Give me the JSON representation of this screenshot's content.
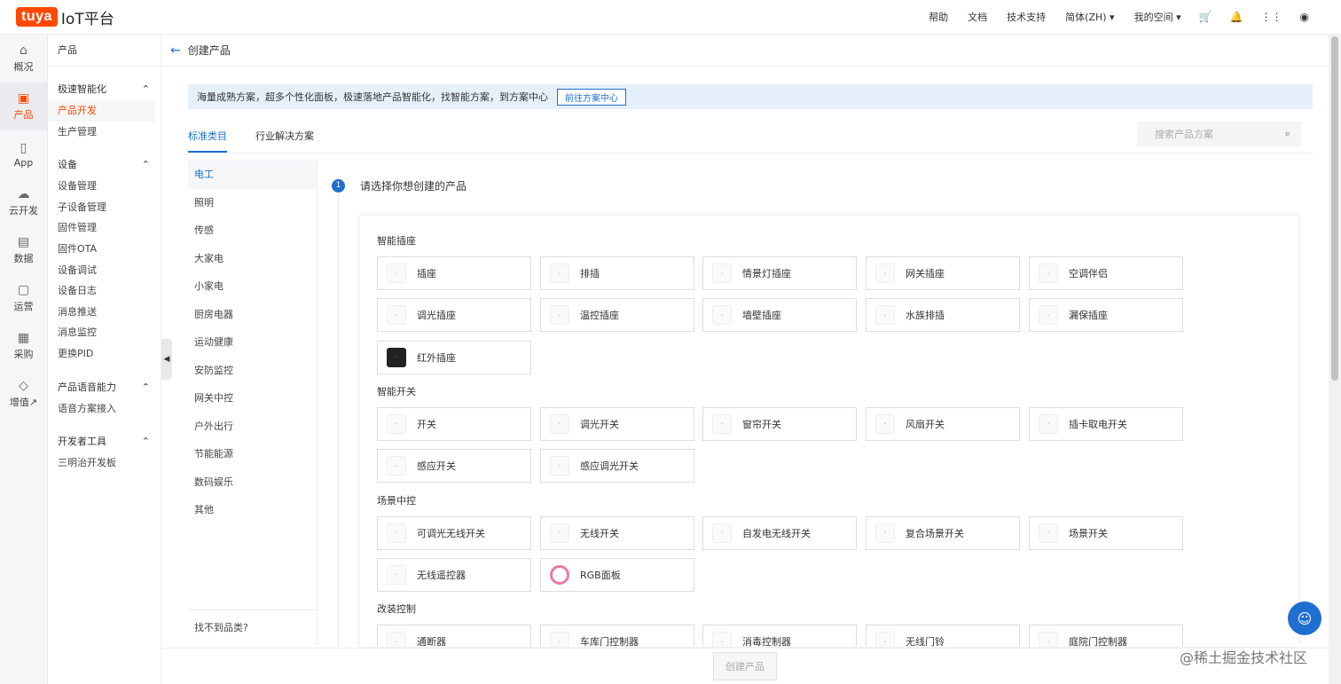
{
  "topbar": {
    "logo_badge": "tuya",
    "logo_text": "IoT平台",
    "nav": [
      "帮助",
      "文档",
      "技术支持",
      "简体(ZH) ▾",
      "我的空间 ▾"
    ],
    "icons": [
      "cart-icon",
      "bell-icon",
      "grid-icon",
      "user-icon"
    ]
  },
  "rail": [
    {
      "label": "概况",
      "icon": "home-icon"
    },
    {
      "label": "产品",
      "icon": "terminal-icon",
      "active": true
    },
    {
      "label": "App",
      "icon": "phone-icon"
    },
    {
      "label": "云开发",
      "icon": "cloud-icon"
    },
    {
      "label": "数据",
      "icon": "chart-icon"
    },
    {
      "label": "运营",
      "icon": "badge-icon"
    },
    {
      "label": "采购",
      "icon": "box-icon"
    },
    {
      "label": "增值↗",
      "icon": "diamond-icon"
    }
  ],
  "sidebar": {
    "header": "产品",
    "groups": [
      {
        "title": "极速智能化",
        "items": [
          "产品开发",
          "生产管理"
        ]
      },
      {
        "title": "设备",
        "items": [
          "设备管理",
          "子设备管理",
          "固件管理",
          "固件OTA",
          "设备调试",
          "设备日志",
          "消息推送",
          "消息监控",
          "更换PID"
        ]
      },
      {
        "title": "产品语音能力",
        "items": [
          "语音方案接入"
        ]
      },
      {
        "title": "开发者工具",
        "items": [
          "三明治开发板"
        ]
      }
    ]
  },
  "main": {
    "page_title": "创建产品",
    "banner_text": "海量成熟方案，超多个性化面板，极速落地产品智能化，找智能方案，到方案中心",
    "banner_button": "前往方案中心",
    "tabs": [
      "标准类目",
      "行业解决方案"
    ],
    "search_placeholder": "搜索产品方案",
    "categories": [
      "电工",
      "照明",
      "传感",
      "大家电",
      "小家电",
      "厨房电器",
      "运动健康",
      "安防监控",
      "网关中控",
      "户外出行",
      "节能能源",
      "数码娱乐",
      "其他"
    ],
    "category_footer": "找不到品类?",
    "step_number": "1",
    "step_text": "请选择你想创建的产品",
    "sections": [
      {
        "title": "智能插座",
        "items": [
          "插座",
          "排插",
          "情景灯插座",
          "网关插座",
          "空调伴侣",
          "调光插座",
          "温控插座",
          "墙壁插座",
          "水族排插",
          "漏保插座",
          "红外插座"
        ]
      },
      {
        "title": "智能开关",
        "items": [
          "开关",
          "调光开关",
          "窗帘开关",
          "风扇开关",
          "插卡取电开关",
          "感应开关",
          "感应调光开关"
        ]
      },
      {
        "title": "场景中控",
        "items": [
          "可调光无线开关",
          "无线开关",
          "自发电无线开关",
          "复合场景开关",
          "场景开关",
          "无线遥控器",
          "RGB面板"
        ]
      },
      {
        "title": "改装控制",
        "items": [
          "通断器",
          "车库门控制器",
          "消毒控制器",
          "无线门铃",
          "庭院门控制器"
        ]
      }
    ],
    "create_button": "创建产品"
  },
  "watermark": "@稀土掘金技术社区"
}
